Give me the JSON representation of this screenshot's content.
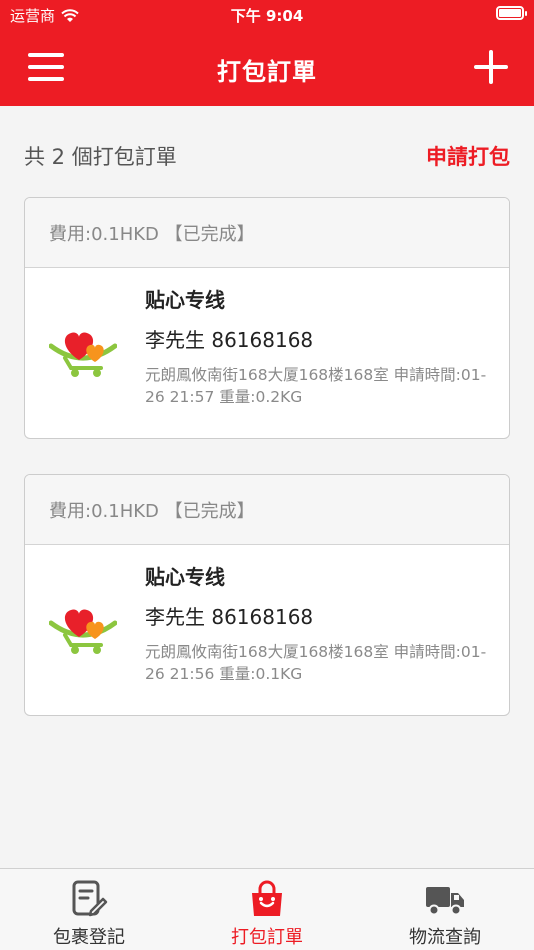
{
  "status_bar": {
    "carrier": "运营商",
    "time": "下午 9:04"
  },
  "nav": {
    "title": "打包訂單",
    "menu_icon": "menu-icon",
    "add_icon": "plus-icon"
  },
  "summary": {
    "count_text": "共 2 個打包訂單",
    "apply_label": "申請打包"
  },
  "orders": [
    {
      "fee": "費用:0.1HKD 【已完成】",
      "name": "贴心专线",
      "contact": "李先生 86168168",
      "detail": "元朗鳳攸南街168大厦168楼168室 申請時間:01-26 21:57 重量:0.2KG"
    },
    {
      "fee": "費用:0.1HKD 【已完成】",
      "name": "贴心专线",
      "contact": "李先生 86168168",
      "detail": "元朗鳳攸南街168大厦168楼168室 申請時間:01-26 21:56 重量:0.1KG"
    }
  ],
  "tabs": [
    {
      "label": "包裹登記",
      "icon": "edit-document-icon",
      "active": false
    },
    {
      "label": "打包訂單",
      "icon": "shopping-bag-icon",
      "active": true
    },
    {
      "label": "物流查詢",
      "icon": "truck-icon",
      "active": false
    }
  ],
  "colors": {
    "brand": "#ed1c24",
    "background": "#f4f4f4"
  }
}
